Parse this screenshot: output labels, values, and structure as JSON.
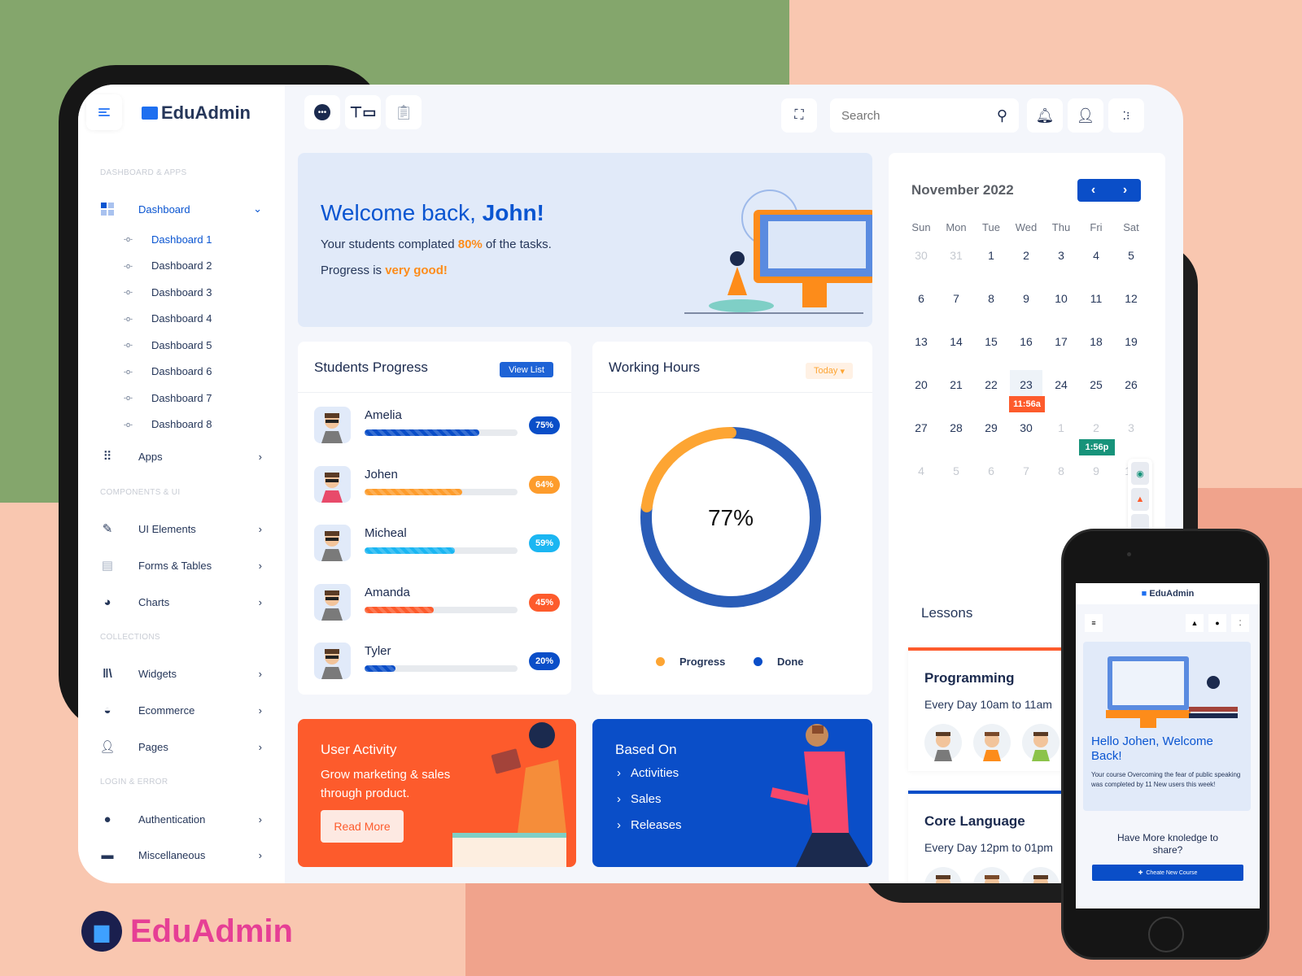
{
  "app": {
    "name": "EduAdmin"
  },
  "sidebar": {
    "sections": [
      "DASHBOARD & APPS",
      "COMPONENTS & UI",
      "COLLECTIONS",
      "LOGIN & ERROR"
    ],
    "dashboard": {
      "label": "Dashboard",
      "icon": "grid-icon",
      "subitems": [
        "Dashboard 1",
        "Dashboard 2",
        "Dashboard 3",
        "Dashboard 4",
        "Dashboard 5",
        "Dashboard 6",
        "Dashboard 7",
        "Dashboard 8"
      ],
      "active_subitem": "Dashboard 1"
    },
    "items": [
      {
        "label": "Apps",
        "icon": "apps-icon"
      },
      {
        "label": "UI Elements",
        "icon": "edit-icon"
      },
      {
        "label": "Forms & Tables",
        "icon": "document-icon"
      },
      {
        "label": "Charts",
        "icon": "pie-chart-icon"
      },
      {
        "label": "Widgets",
        "icon": "library-icon"
      },
      {
        "label": "Ecommerce",
        "icon": "basket-icon"
      },
      {
        "label": "Pages",
        "icon": "user-icon"
      },
      {
        "label": "Authentication",
        "icon": "lock-icon"
      },
      {
        "label": "Miscellaneous",
        "icon": "misc-icon"
      }
    ]
  },
  "topbar": {
    "search": {
      "placeholder": "Search",
      "value": ""
    },
    "icons": [
      "chat-icon",
      "board-icon",
      "clipboard-icon",
      "fullscreen-icon",
      "bell-icon",
      "user-icon",
      "settings-icon"
    ]
  },
  "welcome": {
    "greeting": "Welcome back, ",
    "name": "John!",
    "line1_pre": "Your students complated ",
    "line1_value": "80%",
    "line1_post": " of the tasks.",
    "line2_pre": "Progress is ",
    "line2_value": "very good!"
  },
  "students_progress": {
    "title": "Students Progress",
    "button": "View List",
    "students": [
      {
        "name": "Amelia",
        "percent": 75,
        "label": "75%",
        "color": "#0a4ec8"
      },
      {
        "name": "Johen",
        "percent": 64,
        "label": "64%",
        "color": "#fd9c2c"
      },
      {
        "name": "Micheal",
        "percent": 59,
        "label": "59%",
        "color": "#1bb6f2"
      },
      {
        "name": "Amanda",
        "percent": 45,
        "label": "45%",
        "color": "#fd5b2c"
      },
      {
        "name": "Tyler",
        "percent": 20,
        "label": "20%",
        "color": "#0a4ec8"
      }
    ]
  },
  "working_hours": {
    "title": "Working Hours",
    "filter": "Today",
    "center_label": "77%",
    "legend": [
      {
        "label": "Progress",
        "color": "#fda533"
      },
      {
        "label": "Done",
        "color": "#0a4ec8"
      }
    ]
  },
  "chart_data": {
    "type": "pie",
    "title": "Working Hours",
    "categories": [
      "Progress",
      "Done"
    ],
    "values": [
      23,
      77
    ],
    "colors": [
      "#fda533",
      "#2a5db8"
    ],
    "center_text": "77%",
    "legend": "bottom"
  },
  "user_activity": {
    "title": "User Activity",
    "text_line1": "Grow marketing & sales",
    "text_line2": "through product.",
    "button": "Read More"
  },
  "based_on": {
    "title": "Based On",
    "items": [
      "Activities",
      "Sales",
      "Releases"
    ]
  },
  "calendar": {
    "title": "November 2022",
    "weekdays": [
      "Sun",
      "Mon",
      "Tue",
      "Wed",
      "Thu",
      "Fri",
      "Sat"
    ],
    "weeks": [
      [
        {
          "d": "30",
          "m": true
        },
        {
          "d": "31",
          "m": true
        },
        {
          "d": "1"
        },
        {
          "d": "2"
        },
        {
          "d": "3"
        },
        {
          "d": "4"
        },
        {
          "d": "5"
        }
      ],
      [
        {
          "d": "6"
        },
        {
          "d": "7"
        },
        {
          "d": "8"
        },
        {
          "d": "9"
        },
        {
          "d": "10"
        },
        {
          "d": "11"
        },
        {
          "d": "12"
        }
      ],
      [
        {
          "d": "13"
        },
        {
          "d": "14"
        },
        {
          "d": "15"
        },
        {
          "d": "16"
        },
        {
          "d": "17"
        },
        {
          "d": "18"
        },
        {
          "d": "19"
        }
      ],
      [
        {
          "d": "20"
        },
        {
          "d": "21"
        },
        {
          "d": "22"
        },
        {
          "d": "23",
          "today": true
        },
        {
          "d": "24"
        },
        {
          "d": "25"
        },
        {
          "d": "26"
        }
      ],
      [
        {
          "d": "27"
        },
        {
          "d": "28"
        },
        {
          "d": "29"
        },
        {
          "d": "30"
        },
        {
          "d": "1",
          "m": true
        },
        {
          "d": "2",
          "m": true
        },
        {
          "d": "3",
          "m": true
        }
      ],
      [
        {
          "d": "4",
          "m": true
        },
        {
          "d": "5",
          "m": true
        },
        {
          "d": "6",
          "m": true
        },
        {
          "d": "7",
          "m": true
        },
        {
          "d": "8",
          "m": true
        },
        {
          "d": "9",
          "m": true
        },
        {
          "d": "10",
          "m": true
        }
      ]
    ],
    "events": [
      {
        "label": "11:56a",
        "week": 3,
        "day": 3,
        "color": "#fd5b2c"
      },
      {
        "label": "1:56p",
        "week": 4,
        "day": 5,
        "color": "#17937a"
      }
    ]
  },
  "lessons": {
    "title": "Lessons",
    "items": [
      {
        "name": "Programming",
        "schedule": "Every Day 10am to 11am",
        "color": "#fd5b2c"
      },
      {
        "name": "Core Language",
        "schedule": "Every Day 12pm to 01pm",
        "color": "#0a4ec8"
      }
    ]
  },
  "phone": {
    "logo": "EduAdmin",
    "hello": "Hello Johen, Welcome Back!",
    "text": "Your course Overcoming the fear of public speaking was completed by 11 New users this week!",
    "share_q": "Have More knoledge to share?",
    "button": "Cheate New Course"
  },
  "brand": {
    "name": "EduAdmin"
  }
}
